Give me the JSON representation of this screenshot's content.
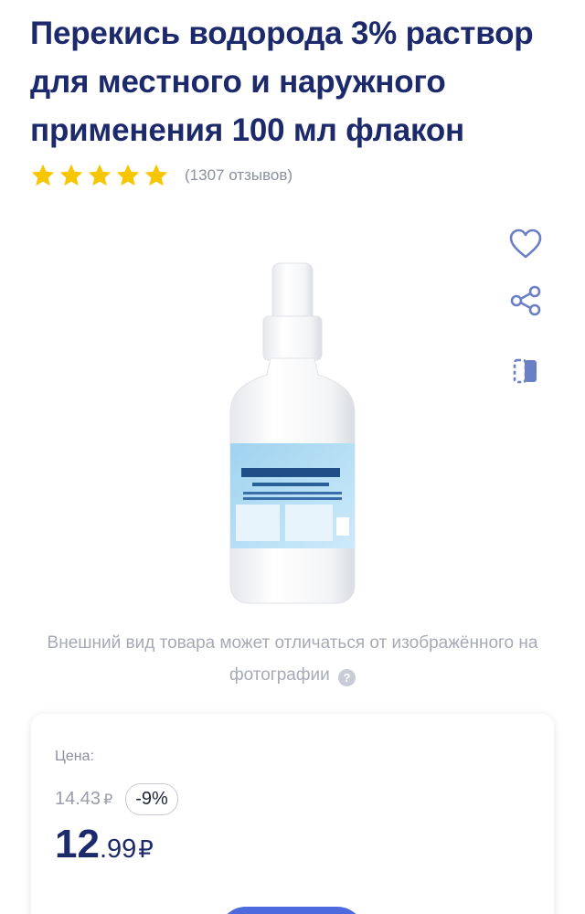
{
  "product": {
    "title": "Перекись водорода 3% раствор для местного и наружного применения 100 мл флакон",
    "rating": 5,
    "reviews_text": "(1307 отзывов)"
  },
  "actions": {
    "favorite_icon": "heart-icon",
    "share_icon": "share-icon",
    "compare_icon": "compare-icon"
  },
  "disclaimer": {
    "text": "Внешний вид товара может отличаться от изображённого на фотографии",
    "help_icon": "question-icon"
  },
  "price": {
    "label": "Цена:",
    "old_price": "14.43",
    "old_currency": "₽",
    "discount": "-9%",
    "current_int": "12",
    "current_frac": ".99",
    "currency": "₽"
  },
  "colors": {
    "title": "#1c2a6b",
    "star": "#f7c600",
    "icon": "#6b7fc4",
    "button": "#4d6bdf"
  }
}
